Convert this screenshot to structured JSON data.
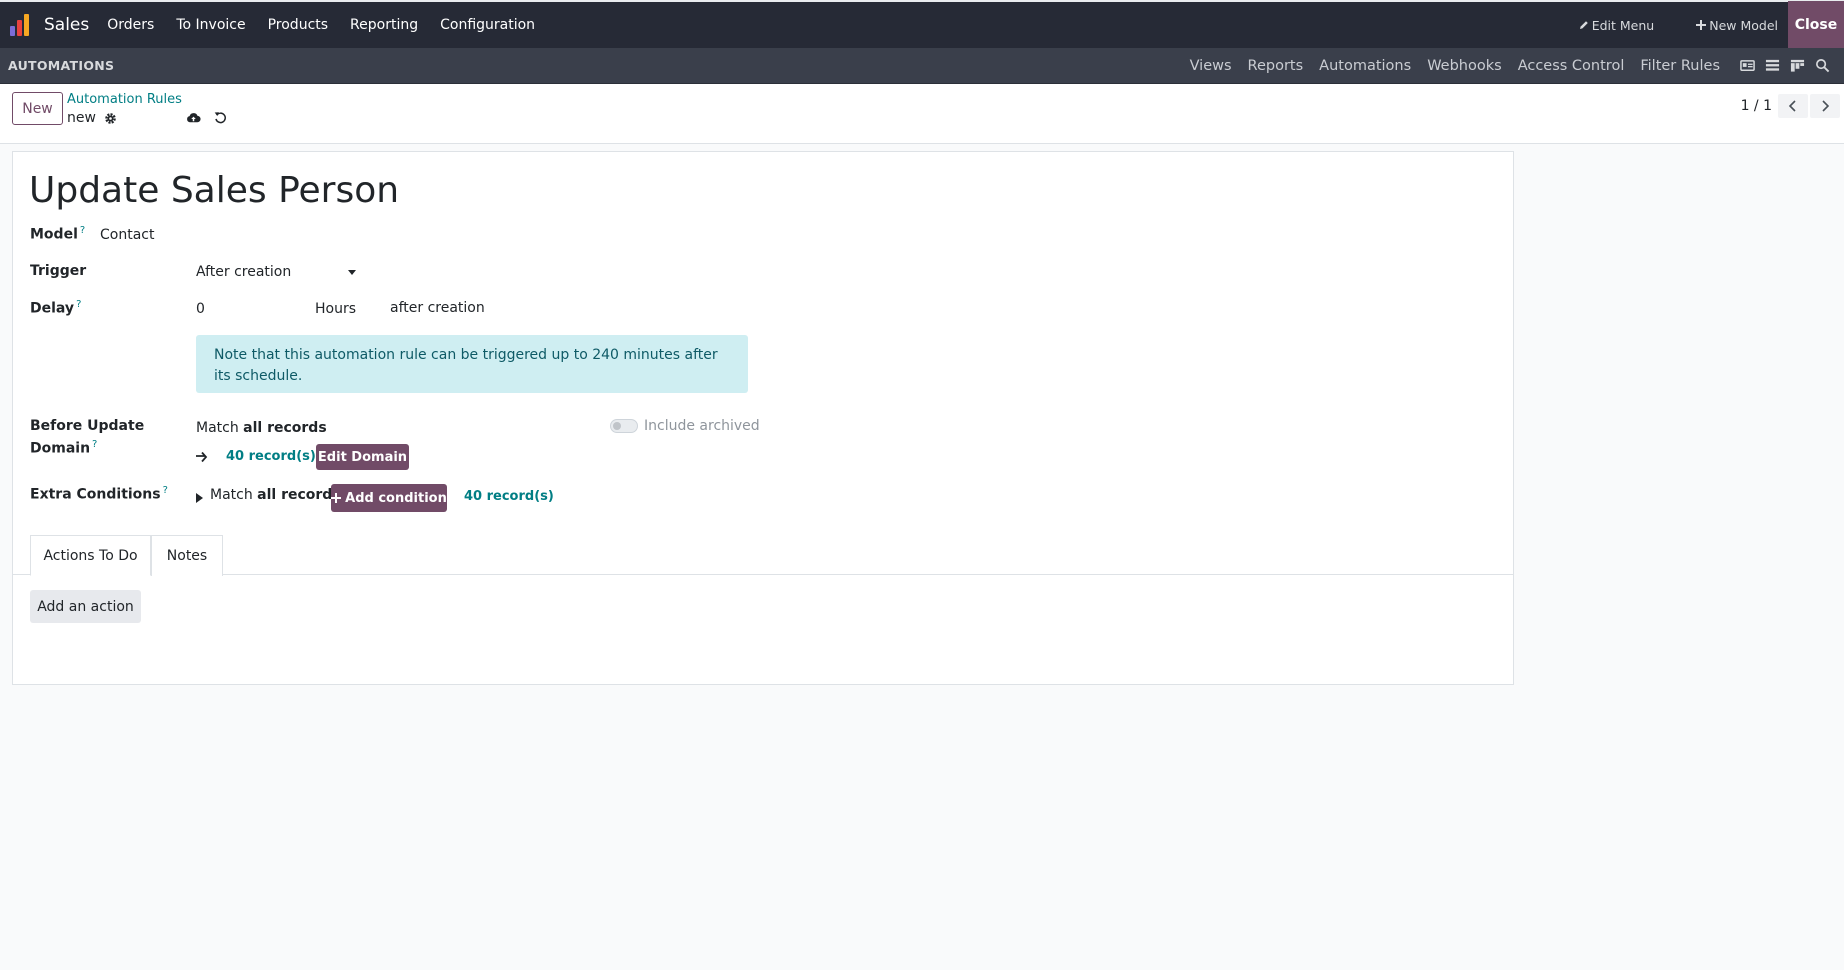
{
  "topnav": {
    "app_name": "Sales",
    "menu": [
      "Orders",
      "To Invoice",
      "Products",
      "Reporting",
      "Configuration"
    ],
    "edit_menu": "Edit Menu",
    "new_model": "New Model",
    "close": "Close",
    "logo_colors": [
      "#7c6cd7",
      "#e8423f",
      "#f7a823",
      "#f7a823"
    ]
  },
  "subnav": {
    "label": "AUTOMATIONS",
    "tabs": [
      "Views",
      "Reports",
      "Automations",
      "Webhooks",
      "Access Control",
      "Filter Rules"
    ]
  },
  "control": {
    "new_label": "New",
    "breadcrumb": "Automation Rules",
    "record_name": "new",
    "pager": "1 / 1"
  },
  "form": {
    "title": "Update Sales Person",
    "model_label": "Model",
    "model_value": "Contact",
    "trigger_label": "Trigger",
    "trigger_value": "After creation",
    "delay_label": "Delay",
    "delay_value": "0",
    "delay_unit": "Hours",
    "delay_suffix": "after creation",
    "alert": "Note that this automation rule can be triggered up to 240 minutes after its schedule.",
    "before_update_label_1": "Before Update",
    "before_update_label_2": "Domain",
    "match_prefix": "Match",
    "match_bold": "all records",
    "include_archived": "Include archived",
    "records_count": "40 record(s)",
    "edit_domain": "Edit Domain",
    "extra_conditions_label": "Extra Conditions",
    "add_condition": "Add condition",
    "extra_records_count": "40 record(s)",
    "help_mark": "?"
  },
  "tabs": {
    "actions": "Actions To Do",
    "notes": "Notes"
  },
  "add_action": "Add an action",
  "colors": {
    "brand": "#714b67",
    "link": "#017e84",
    "navbar": "#262a36"
  }
}
